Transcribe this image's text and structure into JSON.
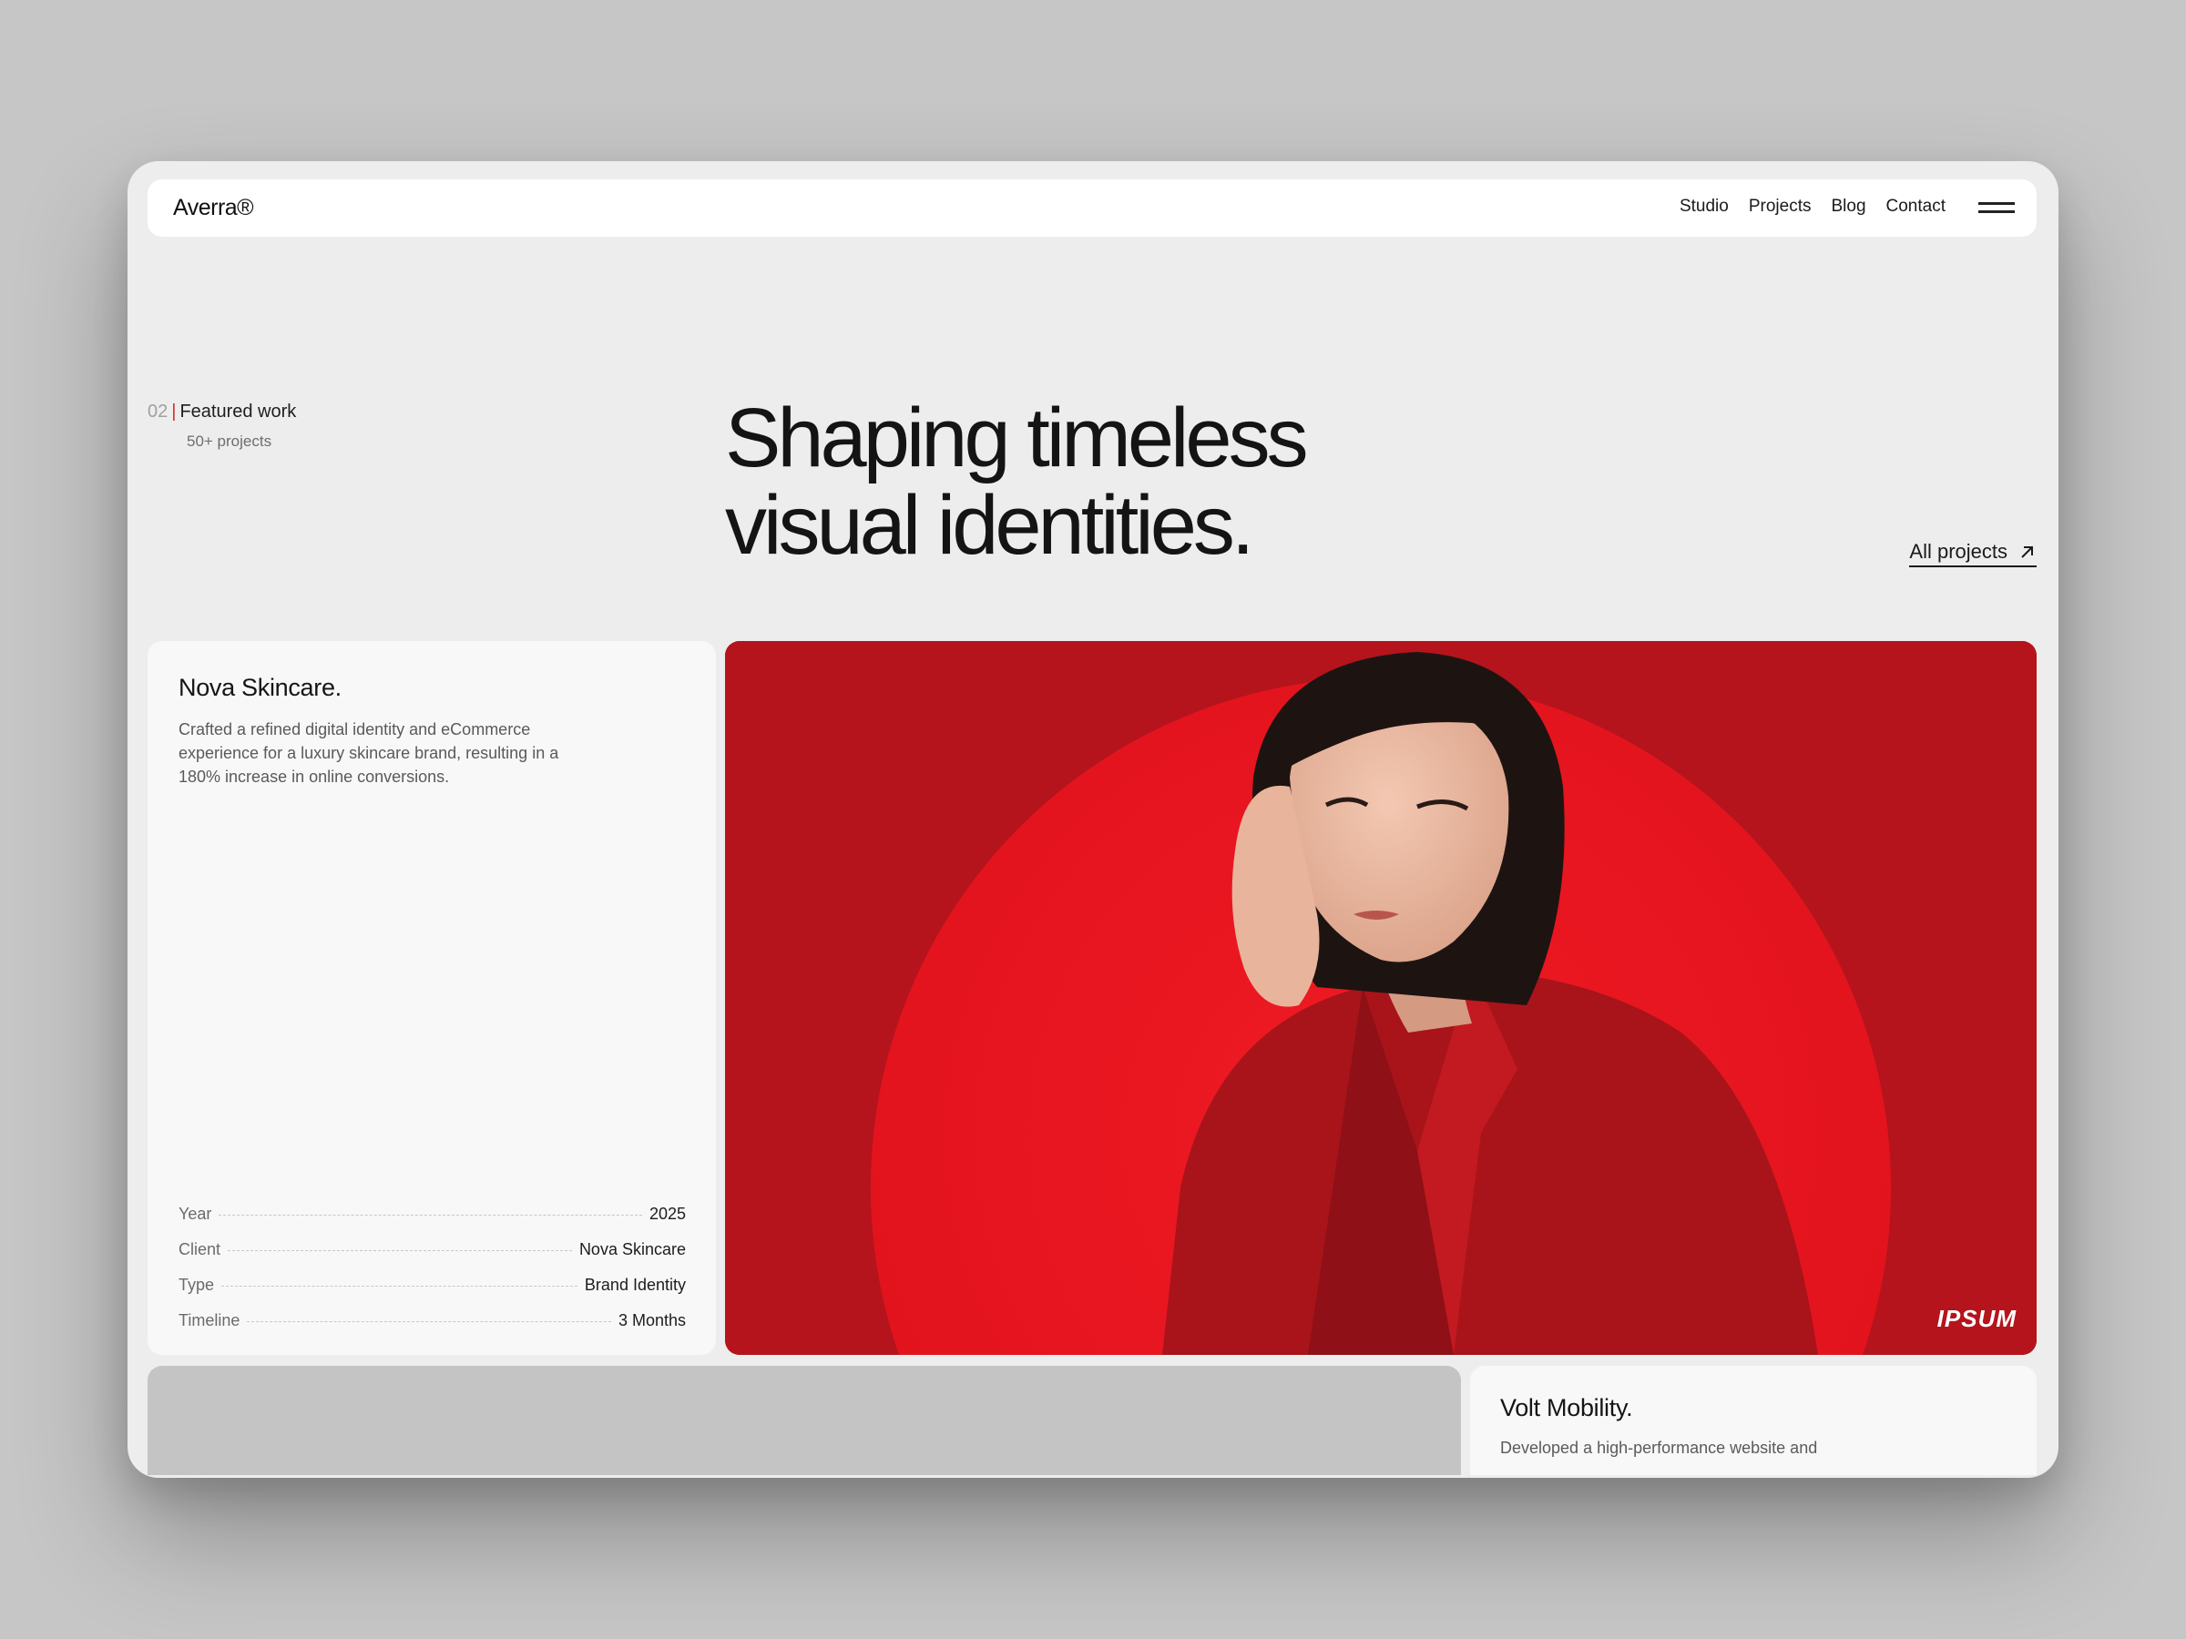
{
  "nav": {
    "logo": "Averra®",
    "links": [
      "Studio",
      "Projects",
      "Blog",
      "Contact"
    ]
  },
  "intro": {
    "section_number": "02",
    "section_separator": "|",
    "section_title": "Featured work",
    "section_subtitle": "50+ projects",
    "headline_line1": "Shaping timeless",
    "headline_line2": "visual identities.",
    "all_projects_label": "All projects"
  },
  "featured": {
    "title": "Nova Skincare.",
    "description": "Crafted a refined digital identity and eCommerce experience for a luxury skincare brand, resulting in a 180% increase in online conversions.",
    "meta": [
      {
        "key": "Year",
        "value": "2025"
      },
      {
        "key": "Client",
        "value": "Nova Skincare"
      },
      {
        "key": "Type",
        "value": "Brand Identity"
      },
      {
        "key": "Timeline",
        "value": "3 Months"
      }
    ],
    "image_brand": "IPSUM"
  },
  "next": {
    "title": "Volt Mobility.",
    "description": "Developed a high-performance website and"
  },
  "colors": {
    "page_bg": "#c6c6c6",
    "window_bg": "#ededed",
    "accent_red": "#e0282b",
    "image_red": "#b5141c"
  },
  "icons": [
    "menu-icon",
    "arrow-up-right-icon"
  ]
}
